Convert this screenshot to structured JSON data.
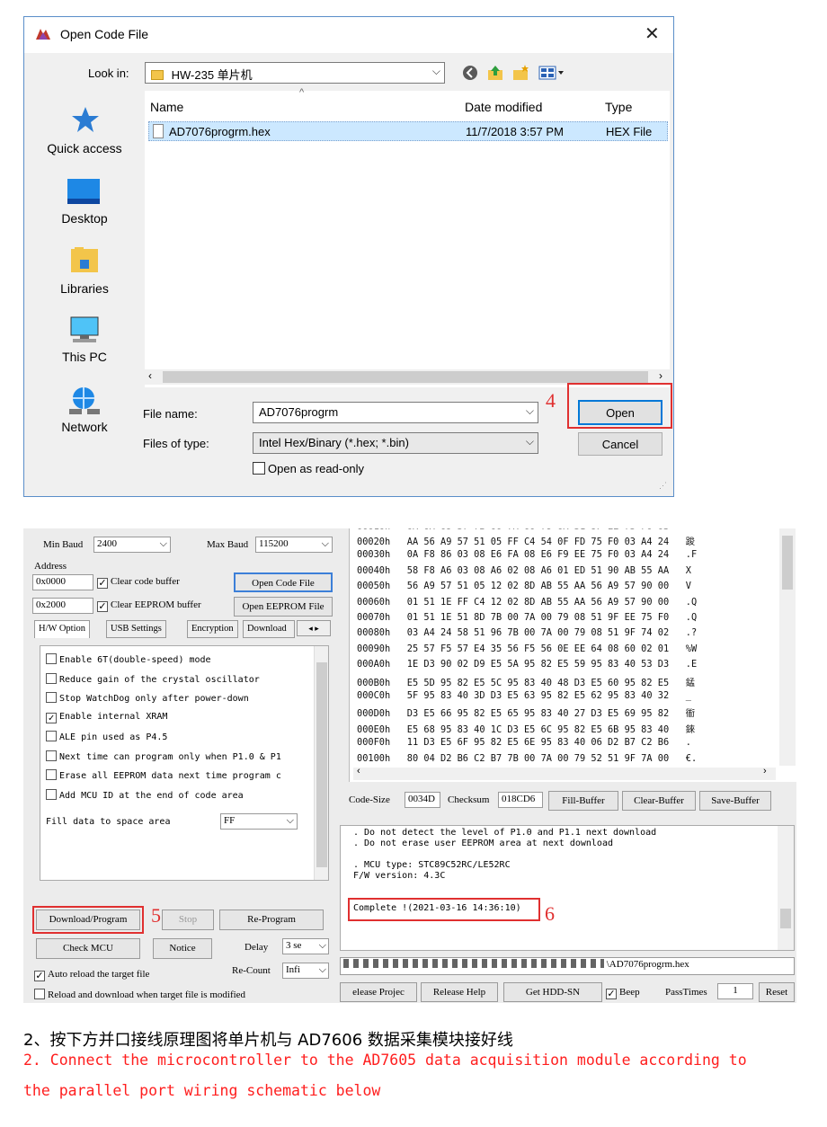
{
  "dialog": {
    "title": "Open Code File",
    "close_glyph": "✕",
    "look_in_label": "Look in:",
    "look_in_value": "HW-235 单片机",
    "places": [
      "Quick access",
      "Desktop",
      "Libraries",
      "This PC",
      "Network"
    ],
    "columns": [
      "Name",
      "Date modified",
      "Type"
    ],
    "files": [
      {
        "name": "AD7076progrm.hex",
        "date": "11/7/2018 3:57 PM",
        "type": "HEX File"
      }
    ],
    "file_name_label": "File name:",
    "file_name_value": "AD7076progrm",
    "file_type_label": "Files of type:",
    "file_type_value": "Intel Hex/Binary (*.hex; *.bin)",
    "read_only_label": "Open as read-only",
    "open_label": "Open",
    "cancel_label": "Cancel",
    "marker": "4",
    "accent": "#0078d7"
  },
  "isp": {
    "min_baud_label": "Min Baud",
    "min_baud_value": "2400",
    "max_baud_label": "Max Baud",
    "max_baud_value": "115200",
    "address_label": "Address",
    "addr1": "0x0000",
    "addr2": "0x2000",
    "clear_code": "Clear code buffer",
    "clear_eeprom": "Clear EEPROM buffer",
    "open_code_file": "Open Code File",
    "open_eeprom_file": "Open EEPROM File",
    "tabs": [
      "H/W Option",
      "USB Settings",
      "Encryption",
      "Download"
    ],
    "options": [
      {
        "label": "Enable 6T(double-speed) mode",
        "checked": false
      },
      {
        "label": "Reduce gain of the crystal oscillator",
        "checked": false
      },
      {
        "label": "Stop WatchDog only after power-down",
        "checked": false
      },
      {
        "label": "Enable internal XRAM",
        "checked": true
      },
      {
        "label": "ALE pin used as P4.5",
        "checked": false
      },
      {
        "label": "Next time can program only when P1.0 & P1",
        "checked": false
      },
      {
        "label": "Erase all EEPROM data next time program c",
        "checked": false
      },
      {
        "label": "Add MCU ID at the end of code area",
        "checked": false
      }
    ],
    "fill_label": "Fill data to space area",
    "fill_value": "FF",
    "download_label": "Download/Program",
    "stop_label": "Stop",
    "reprogram_label": "Re-Program",
    "check_mcu_label": "Check MCU",
    "notice_label": "Notice",
    "delay_label": "Delay",
    "delay_value": "3 se",
    "recount_label": "Re-Count",
    "recount_value": "Infi",
    "auto_reload_label": "Auto reload the target file",
    "reload_download_label": "Reload and download when target file is modified",
    "marker5": "5",
    "marker6": "6",
    "hex_rows": [
      "00020h   AA 56 A9 57 51 05 FF C4 54 0F FD 75 F0 03 A4 24   踆",
      "00030h   0A F8 86 03 08 E6 FA 08 E6 F9 EE 75 F0 03 A4 24   .F",
      "00040h   58 F8 A6 03 08 A6 02 08 A6 01 ED 51 90 AB 55 AA   X",
      "00050h   56 A9 57 51 05 12 02 8D AB 55 AA 56 A9 57 90 00   V",
      "00060h   01 51 1E FF C4 12 02 8D AB 55 AA 56 A9 57 90 00   .Q",
      "00070h   01 51 1E 51 8D 7B 00 7A 00 79 08 51 9F EE 75 F0   .Q",
      "00080h   03 A4 24 58 51 96 7B 00 7A 00 79 08 51 9F 74 02   .?",
      "00090h   25 57 F5 57 E4 35 56 F5 56 0E EE 64 08 60 02 01   %W",
      "000A0h   1E D3 90 02 D9 E5 5A 95 82 E5 59 95 83 40 53 D3   .E",
      "000B0h   E5 5D 95 82 E5 5C 95 83 40 48 D3 E5 60 95 82 E5   錳",
      "000C0h   5F 95 83 40 3D D3 E5 63 95 82 E5 62 95 83 40 32   _",
      "000D0h   D3 E5 66 95 82 E5 65 95 83 40 27 D3 E5 69 95 82   衜",
      "000E0h   E5 68 95 83 40 1C D3 E5 6C 95 82 E5 6B 95 83 40   錸",
      "000F0h   11 D3 E5 6F 95 82 E5 6E 95 83 40 06 D2 B7 C2 B6   .",
      "00100h   80 04 D2 B6 C2 B7 7B 00 7A 00 79 52 51 9F 7A 00   €."
    ],
    "code_size_label": "Code-Size",
    "code_size_value": "0034D",
    "checksum_label": "Checksum",
    "checksum_value": "018CD6",
    "fill_buffer": "Fill-Buffer",
    "clear_buffer": "Clear-Buffer",
    "save_buffer": "Save-Buffer",
    "log_lines": [
      ". Do not detect the level of P1.0 and P1.1 next download",
      ". Do not erase user EEPROM area at next download",
      "",
      ". MCU type: STC89C52RC/LE52RC",
      "F/W version: 4.3C"
    ],
    "complete_msg": "Complete !(2021-03-16 14:36:10)",
    "path_value": "\\AD7076progrm.hex",
    "release_project": "elease Projec",
    "release_help": "Release Help",
    "get_hdd": "Get HDD-SN",
    "beep_label": "Beep",
    "pass_times_label": "PassTimes",
    "pass_times_value": "1",
    "reset_label": "Reset"
  },
  "captions": {
    "cn": "2、按下方并口接线原理图将单片机与 AD7606 数据采集模块接好线",
    "en_line1": "2. Connect the microcontroller to the AD7605 data acquisition module according to",
    "en_line2": "the parallel port wiring schematic below"
  }
}
